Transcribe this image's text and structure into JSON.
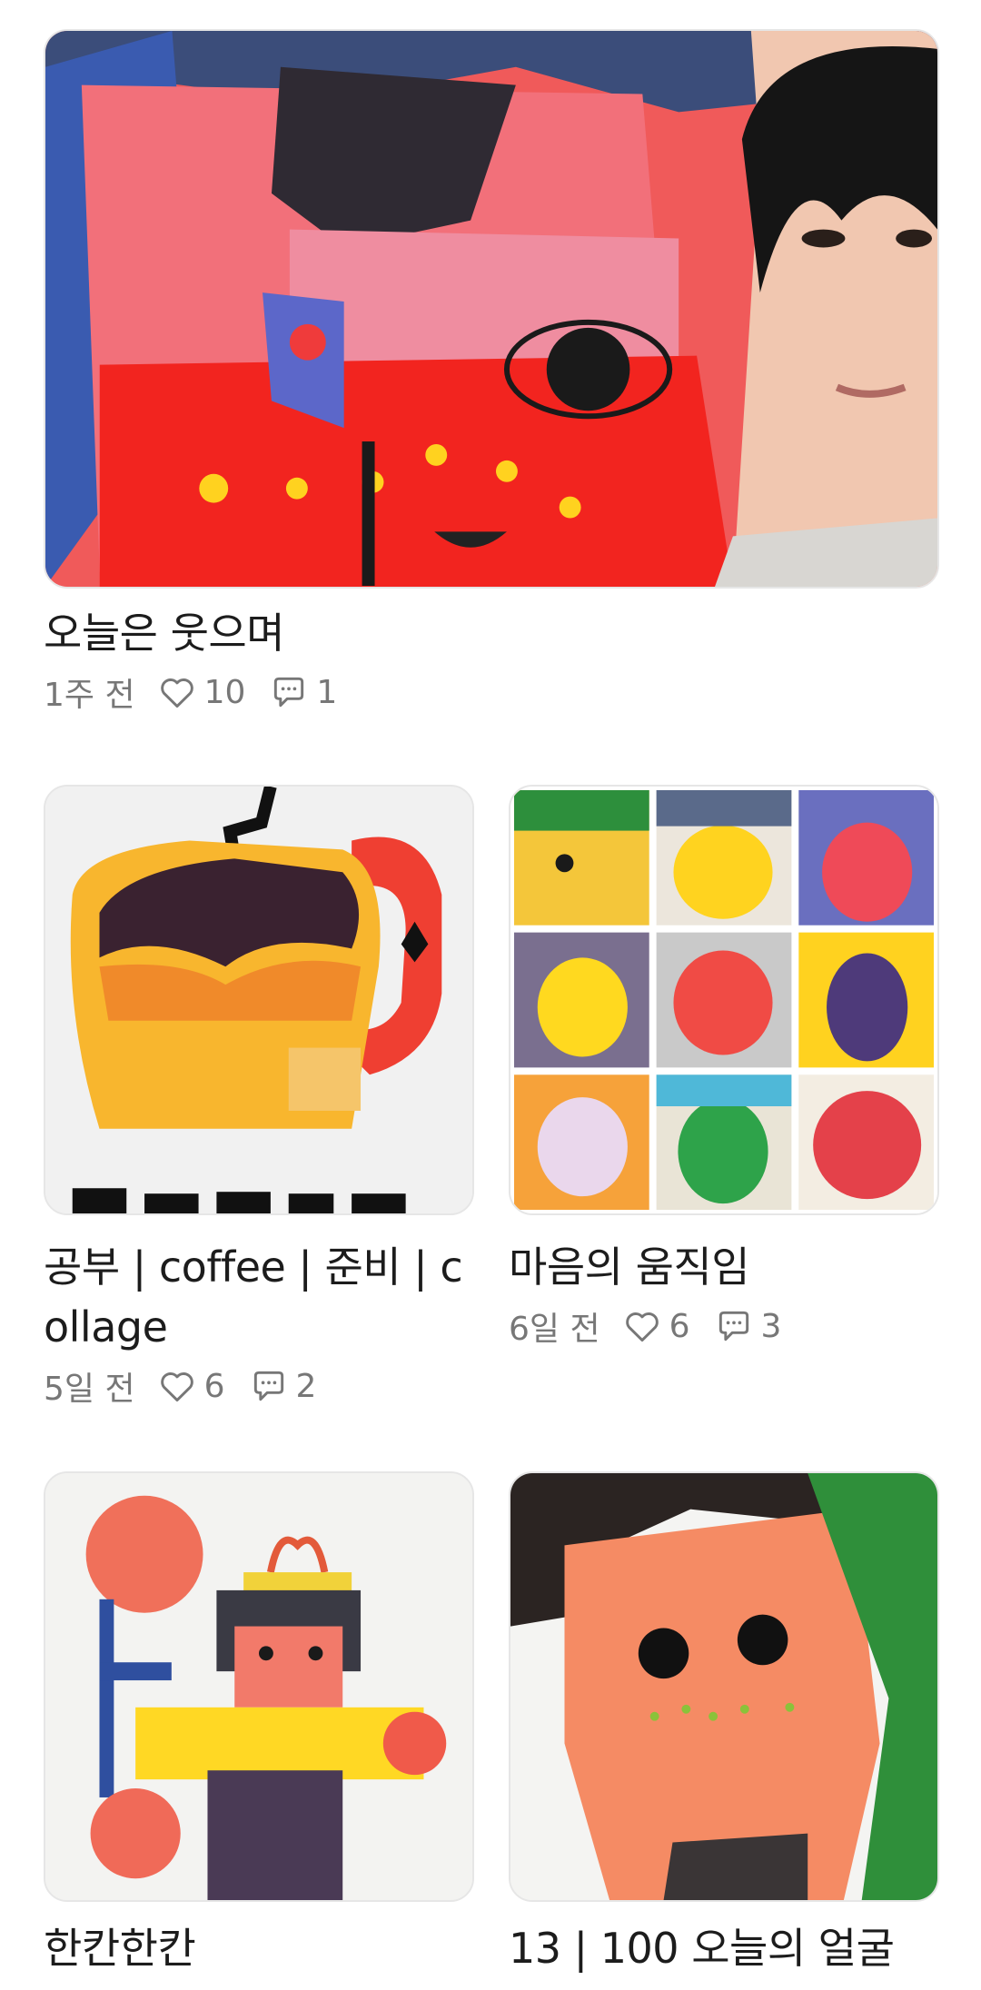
{
  "posts": [
    {
      "title": "오늘은 웃으며",
      "time": "1주 전",
      "likes": "10",
      "comments": "1",
      "image": "collage-face-with-artist"
    },
    {
      "title": "공부 | coffee | 준비 | collage",
      "time": "5일 전",
      "likes": "6",
      "comments": "2",
      "image": "collage-coffee-cup"
    },
    {
      "title": "마음의 움직임",
      "time": "6일 전",
      "likes": "6",
      "comments": "3",
      "image": "collage-faces-grid"
    },
    {
      "title": "한칸한칸",
      "image": "mosaic-girl-with-flower"
    },
    {
      "title": "13 | 100 오늘의 얼굴",
      "image": "collage-orange-face"
    }
  ],
  "icons": {
    "like": "heart-icon",
    "comment": "comment-icon"
  },
  "colors": {
    "text": "#1c1c1c",
    "meta": "#777777",
    "border": "#e6e6e6"
  }
}
